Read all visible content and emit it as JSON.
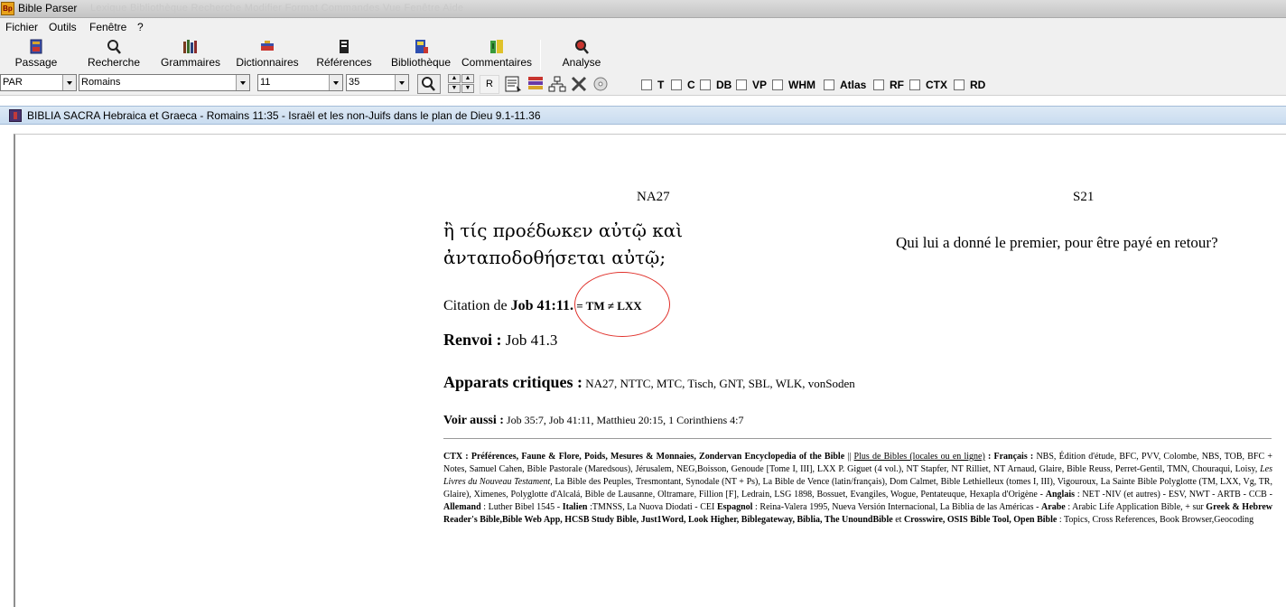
{
  "window": {
    "title": "Bible Parser",
    "logo_text": "Bp",
    "ghost_menu": "Lexique   Bibliothèque   Recherche   Modifier   Format   Commandes   Vue   Fenêtre   Aide"
  },
  "menu": [
    "Fichier",
    "Outils",
    "Fenêtre",
    "?"
  ],
  "toolbar": [
    {
      "label": "Passage",
      "icon": "book-icon"
    },
    {
      "label": "Recherche",
      "icon": "search-icon"
    },
    {
      "label": "Grammaires",
      "icon": "books-icon"
    },
    {
      "label": "Dictionnaires",
      "icon": "dictionary-icon"
    },
    {
      "label": "Références",
      "icon": "references-icon"
    },
    {
      "label": "Bibliothèque",
      "icon": "library-icon"
    },
    {
      "label": "Commentaires",
      "icon": "comments-icon"
    },
    {
      "label": "Analyse",
      "icon": "analysis-icon"
    }
  ],
  "options": {
    "version": "PAR",
    "book": "Romains",
    "chapter": "11",
    "verse": "35",
    "r_label": "R",
    "checkboxes": [
      "T",
      "C",
      "DB",
      "VP",
      "WHM",
      "Atlas",
      "RF",
      "CTX",
      "RD"
    ]
  },
  "subwindow": {
    "title": "BIBLIA SACRA Hebraica et Graeca - Romains 11:35 - Israël et les non-Juifs dans le plan de Dieu 9.1-11.36"
  },
  "content": {
    "left_header": "NA27",
    "right_header": "S21",
    "greek_text": "ἢ τίς προέδωκεν αὐτῷ καὶ ἀνταποδοθήσεται αὐτῷ;",
    "french_text": "Qui lui a donné le premier, pour être payé en retour?",
    "citation_label": "Citation de ",
    "citation_ref": "Job 41:11.",
    "citation_note": " = TM ≠ LXX",
    "renvoi_label": "Renvoi :",
    "renvoi_value": " Job 41.3",
    "apparats_label": "Apparats critiques :",
    "apparats_value": " NA27, NTTC, MTC, Tisch, GNT, SBL, WLK, vonSoden",
    "voir_label": "Voir aussi :",
    "voir_value": " Job 35:7, Job 41:11, Matthieu 20:15, 1 Corinthiens 4:7",
    "ctx": {
      "label": "CTX : ",
      "links1": "Préférences, Faune & Flore, Poids, Mesures & Monnaies, Zondervan Encyclopedia of the Bible",
      "sep": " || ",
      "plus": "Plus de Bibles (locales ou en ligne)",
      "fr_label": " : Français : ",
      "fr_list_a": "NBS, Édition d'étude, BFC, PVV, Colombe, NBS, TOB, BFC + Notes, Samuel Cahen, Bible Pastorale (Maredsous), Jérusalem, NEG,Boisson, Genoude [Tome I, III], LXX P. Giguet (4 vol.), NT Stapfer, NT Rilliet, NT Arnaud, Glaire, Bible Reuss, Perret-Gentil, TMN, Chouraqui, Loisy, ",
      "fr_italic": "Les Livres du Nouveau Testament",
      "fr_list_b": ", La Bible des Peuples, Tresmontant, Synodale (NT + Ps), La Bible de Vence (latin/français), Dom Calmet, Bible Lethielleux (tomes I, III), Vigouroux, La Sainte Bible Polyglotte (TM, LXX, Vg, TR, Glaire), Ximenes, Polyglotte d'Alcalá, Bible de Lausanne, Oltramare, Fillion [F], Ledrain, LSG 1898, Bossuet, Evangiles, Wogue, Pentateuque, Hexapla d'Origène - ",
      "en_label": "Anglais",
      "en_list": " : NET -NIV (et autres) - ESV, NWT - ARTB - CCB - ",
      "de_label": "Allemand",
      "de_list": " : Luther Bibel 1545 - ",
      "it_label": "Italien",
      "it_list": " :TMNSS, La Nuova Diodati - CEI ",
      "es_label": "Espagnol",
      "es_list": " : Reina-Valera 1995, Nueva Versión Internacional, La Biblia de las Américas - ",
      "ar_label": "Arabe",
      "ar_list": " : Arabic Life Application Bible, + sur ",
      "sites_a": "Greek & Hebrew Reader's Bible,Bible Web App, HCSB Study Bible, Just1Word, Look Higher, Biblegateway, Biblia, The UnoundBible",
      "et": " et ",
      "sites_b": "Crosswire, OSIS Bible Tool, Open Bible",
      "tail": " : Topics, Cross References, Book Browser,Geocoding"
    }
  }
}
